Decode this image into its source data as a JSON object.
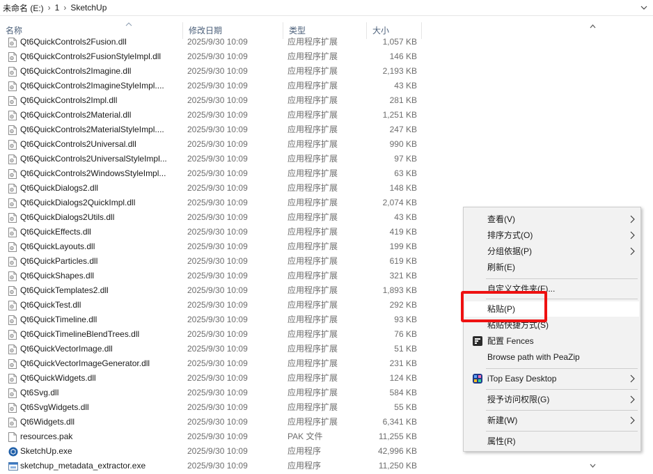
{
  "address": {
    "crumbs": [
      "未命名 (E:)",
      "1",
      "SketchUp"
    ],
    "separator": "›"
  },
  "header": {
    "name": "名称",
    "date": "修改日期",
    "type": "类型",
    "size": "大小"
  },
  "files": [
    {
      "name": "Qt6QuickControls2Fusion.dll",
      "date": "2025/9/30 10:09",
      "type": "应用程序扩展",
      "size": "1,057 KB",
      "icon": "dll-file-icon"
    },
    {
      "name": "Qt6QuickControls2FusionStyleImpl.dll",
      "date": "2025/9/30 10:09",
      "type": "应用程序扩展",
      "size": "146 KB",
      "icon": "dll-file-icon"
    },
    {
      "name": "Qt6QuickControls2Imagine.dll",
      "date": "2025/9/30 10:09",
      "type": "应用程序扩展",
      "size": "2,193 KB",
      "icon": "dll-file-icon"
    },
    {
      "name": "Qt6QuickControls2ImagineStyleImpl....",
      "date": "2025/9/30 10:09",
      "type": "应用程序扩展",
      "size": "43 KB",
      "icon": "dll-file-icon"
    },
    {
      "name": "Qt6QuickControls2Impl.dll",
      "date": "2025/9/30 10:09",
      "type": "应用程序扩展",
      "size": "281 KB",
      "icon": "dll-file-icon"
    },
    {
      "name": "Qt6QuickControls2Material.dll",
      "date": "2025/9/30 10:09",
      "type": "应用程序扩展",
      "size": "1,251 KB",
      "icon": "dll-file-icon"
    },
    {
      "name": "Qt6QuickControls2MaterialStyleImpl....",
      "date": "2025/9/30 10:09",
      "type": "应用程序扩展",
      "size": "247 KB",
      "icon": "dll-file-icon"
    },
    {
      "name": "Qt6QuickControls2Universal.dll",
      "date": "2025/9/30 10:09",
      "type": "应用程序扩展",
      "size": "990 KB",
      "icon": "dll-file-icon"
    },
    {
      "name": "Qt6QuickControls2UniversalStyleImpl...",
      "date": "2025/9/30 10:09",
      "type": "应用程序扩展",
      "size": "97 KB",
      "icon": "dll-file-icon"
    },
    {
      "name": "Qt6QuickControls2WindowsStyleImpl...",
      "date": "2025/9/30 10:09",
      "type": "应用程序扩展",
      "size": "63 KB",
      "icon": "dll-file-icon"
    },
    {
      "name": "Qt6QuickDialogs2.dll",
      "date": "2025/9/30 10:09",
      "type": "应用程序扩展",
      "size": "148 KB",
      "icon": "dll-file-icon"
    },
    {
      "name": "Qt6QuickDialogs2QuickImpl.dll",
      "date": "2025/9/30 10:09",
      "type": "应用程序扩展",
      "size": "2,074 KB",
      "icon": "dll-file-icon"
    },
    {
      "name": "Qt6QuickDialogs2Utils.dll",
      "date": "2025/9/30 10:09",
      "type": "应用程序扩展",
      "size": "43 KB",
      "icon": "dll-file-icon"
    },
    {
      "name": "Qt6QuickEffects.dll",
      "date": "2025/9/30 10:09",
      "type": "应用程序扩展",
      "size": "419 KB",
      "icon": "dll-file-icon"
    },
    {
      "name": "Qt6QuickLayouts.dll",
      "date": "2025/9/30 10:09",
      "type": "应用程序扩展",
      "size": "199 KB",
      "icon": "dll-file-icon"
    },
    {
      "name": "Qt6QuickParticles.dll",
      "date": "2025/9/30 10:09",
      "type": "应用程序扩展",
      "size": "619 KB",
      "icon": "dll-file-icon"
    },
    {
      "name": "Qt6QuickShapes.dll",
      "date": "2025/9/30 10:09",
      "type": "应用程序扩展",
      "size": "321 KB",
      "icon": "dll-file-icon"
    },
    {
      "name": "Qt6QuickTemplates2.dll",
      "date": "2025/9/30 10:09",
      "type": "应用程序扩展",
      "size": "1,893 KB",
      "icon": "dll-file-icon"
    },
    {
      "name": "Qt6QuickTest.dll",
      "date": "2025/9/30 10:09",
      "type": "应用程序扩展",
      "size": "292 KB",
      "icon": "dll-file-icon"
    },
    {
      "name": "Qt6QuickTimeline.dll",
      "date": "2025/9/30 10:09",
      "type": "应用程序扩展",
      "size": "93 KB",
      "icon": "dll-file-icon"
    },
    {
      "name": "Qt6QuickTimelineBlendTrees.dll",
      "date": "2025/9/30 10:09",
      "type": "应用程序扩展",
      "size": "76 KB",
      "icon": "dll-file-icon"
    },
    {
      "name": "Qt6QuickVectorImage.dll",
      "date": "2025/9/30 10:09",
      "type": "应用程序扩展",
      "size": "51 KB",
      "icon": "dll-file-icon"
    },
    {
      "name": "Qt6QuickVectorImageGenerator.dll",
      "date": "2025/9/30 10:09",
      "type": "应用程序扩展",
      "size": "231 KB",
      "icon": "dll-file-icon"
    },
    {
      "name": "Qt6QuickWidgets.dll",
      "date": "2025/9/30 10:09",
      "type": "应用程序扩展",
      "size": "124 KB",
      "icon": "dll-file-icon"
    },
    {
      "name": "Qt6Svg.dll",
      "date": "2025/9/30 10:09",
      "type": "应用程序扩展",
      "size": "584 KB",
      "icon": "dll-file-icon"
    },
    {
      "name": "Qt6SvgWidgets.dll",
      "date": "2025/9/30 10:09",
      "type": "应用程序扩展",
      "size": "55 KB",
      "icon": "dll-file-icon"
    },
    {
      "name": "Qt6Widgets.dll",
      "date": "2025/9/30 10:09",
      "type": "应用程序扩展",
      "size": "6,341 KB",
      "icon": "dll-file-icon"
    },
    {
      "name": "resources.pak",
      "date": "2025/9/30 10:09",
      "type": "PAK 文件",
      "size": "11,255 KB",
      "icon": "blank-file-icon"
    },
    {
      "name": "SketchUp.exe",
      "date": "2025/9/30 10:09",
      "type": "应用程序",
      "size": "42,996 KB",
      "icon": "sketchup-app-icon"
    },
    {
      "name": "sketchup_metadata_extractor.exe",
      "date": "2025/9/30 10:09",
      "type": "应用程序",
      "size": "11,250 KB",
      "icon": "exe-app-icon"
    }
  ],
  "context_menu": {
    "items": [
      {
        "label": "查看(V)",
        "submenu": true
      },
      {
        "label": "排序方式(O)",
        "submenu": true
      },
      {
        "label": "分组依据(P)",
        "submenu": true
      },
      {
        "label": "刷新(E)",
        "submenu": false
      },
      {
        "label": "自定义文件夹(F)...",
        "submenu": false
      },
      {
        "label": "粘贴(P)",
        "submenu": false
      },
      {
        "label": "粘贴快捷方式(S)",
        "submenu": false
      },
      {
        "label": "配置 Fences",
        "submenu": false,
        "icon": "fences-icon"
      },
      {
        "label": "Browse path with PeaZip",
        "submenu": false
      },
      {
        "label": "iTop Easy Desktop",
        "submenu": true,
        "icon": "itop-icon"
      },
      {
        "label": "授予访问权限(G)",
        "submenu": true
      },
      {
        "label": "新建(W)",
        "submenu": true
      },
      {
        "label": "属性(R)",
        "submenu": false
      }
    ]
  },
  "colors": {
    "highlight_box": "#ee1111",
    "header_text": "#4c607a",
    "menu_bg": "#f2f2f2"
  }
}
